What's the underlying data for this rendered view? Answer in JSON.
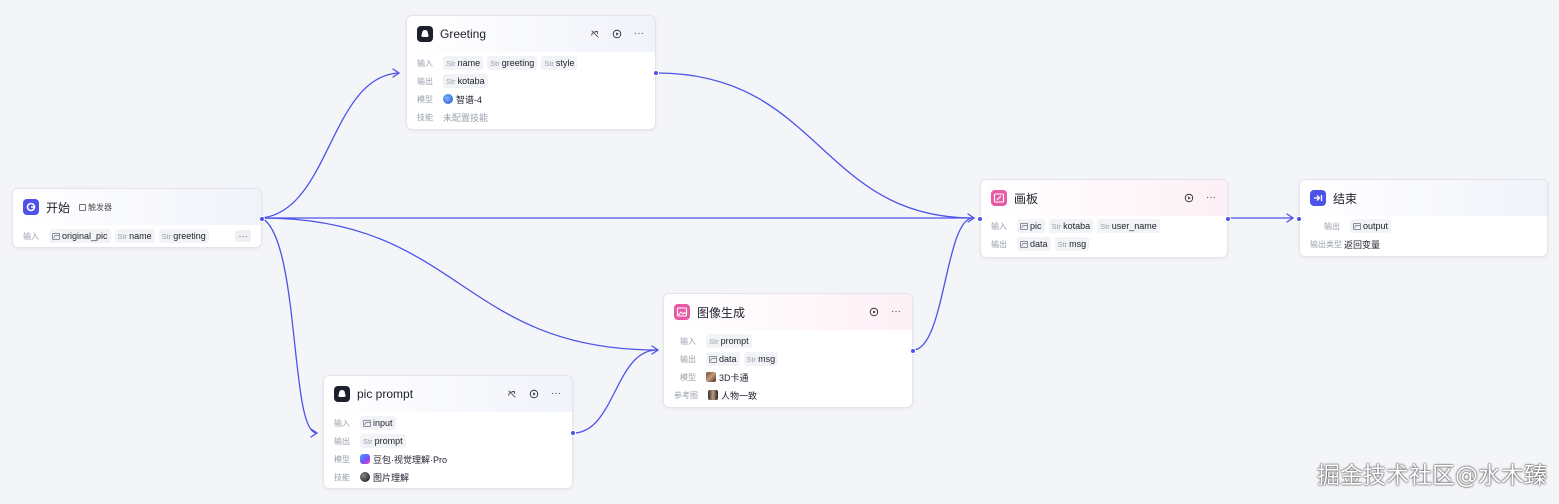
{
  "colors": {
    "edge": "#4d53e8",
    "node_blue_icon": "#4d53e8",
    "node_pink_icon": "#e85aa6",
    "node_dark_icon": "#1d1f2b"
  },
  "nodes": {
    "start": {
      "title": "开始",
      "trigger": "触发器",
      "input_label": "输入",
      "inputs": [
        {
          "type_icon": "image-icon",
          "name": "original_pic"
        },
        {
          "type": "Str",
          "name": "name"
        },
        {
          "type": "Str",
          "name": "greeting"
        }
      ],
      "more": "···"
    },
    "greeting": {
      "title": "Greeting",
      "input_label": "输入",
      "inputs": [
        {
          "type": "Str",
          "name": "name"
        },
        {
          "type": "Str",
          "name": "greeting"
        },
        {
          "type": "Str",
          "name": "style"
        }
      ],
      "output_label": "输出",
      "outputs": [
        {
          "type": "Str",
          "name": "kotaba"
        }
      ],
      "model_label": "模型",
      "model": "智谱-4",
      "skill_label": "技能",
      "skill": "未配置技能"
    },
    "pic_prompt": {
      "title": "pic prompt",
      "input_label": "输入",
      "inputs": [
        {
          "type_icon": "image-icon",
          "name": "input"
        }
      ],
      "output_label": "输出",
      "outputs": [
        {
          "type": "Str",
          "name": "prompt"
        }
      ],
      "model_label": "模型",
      "model": "豆包·视觉理解·Pro",
      "skill_label": "技能",
      "skill": "图片理解"
    },
    "image_gen": {
      "title": "图像生成",
      "input_label": "输入",
      "inputs": [
        {
          "type": "Str",
          "name": "prompt"
        }
      ],
      "output_label": "输出",
      "outputs": [
        {
          "type_icon": "image-icon",
          "name": "data"
        },
        {
          "type": "Str",
          "name": "msg"
        }
      ],
      "model_label": "模型",
      "model": "3D卡通",
      "ref_label": "参考图",
      "ref": "人物一致"
    },
    "canvas": {
      "title": "画板",
      "input_label": "输入",
      "inputs": [
        {
          "type_icon": "image-icon",
          "name": "pic"
        },
        {
          "type": "Str",
          "name": "kotaba"
        },
        {
          "type": "Str",
          "name": "user_name"
        }
      ],
      "output_label": "输出",
      "outputs": [
        {
          "type_icon": "image-icon",
          "name": "data"
        },
        {
          "type": "Str",
          "name": "msg"
        }
      ]
    },
    "end": {
      "title": "结束",
      "output_label": "输出",
      "outputs": [
        {
          "type_icon": "image-icon",
          "name": "output"
        }
      ],
      "output_type_label": "输出类型",
      "output_type": "返回变量"
    }
  },
  "watermark": "掘金技术社区@水木臻"
}
